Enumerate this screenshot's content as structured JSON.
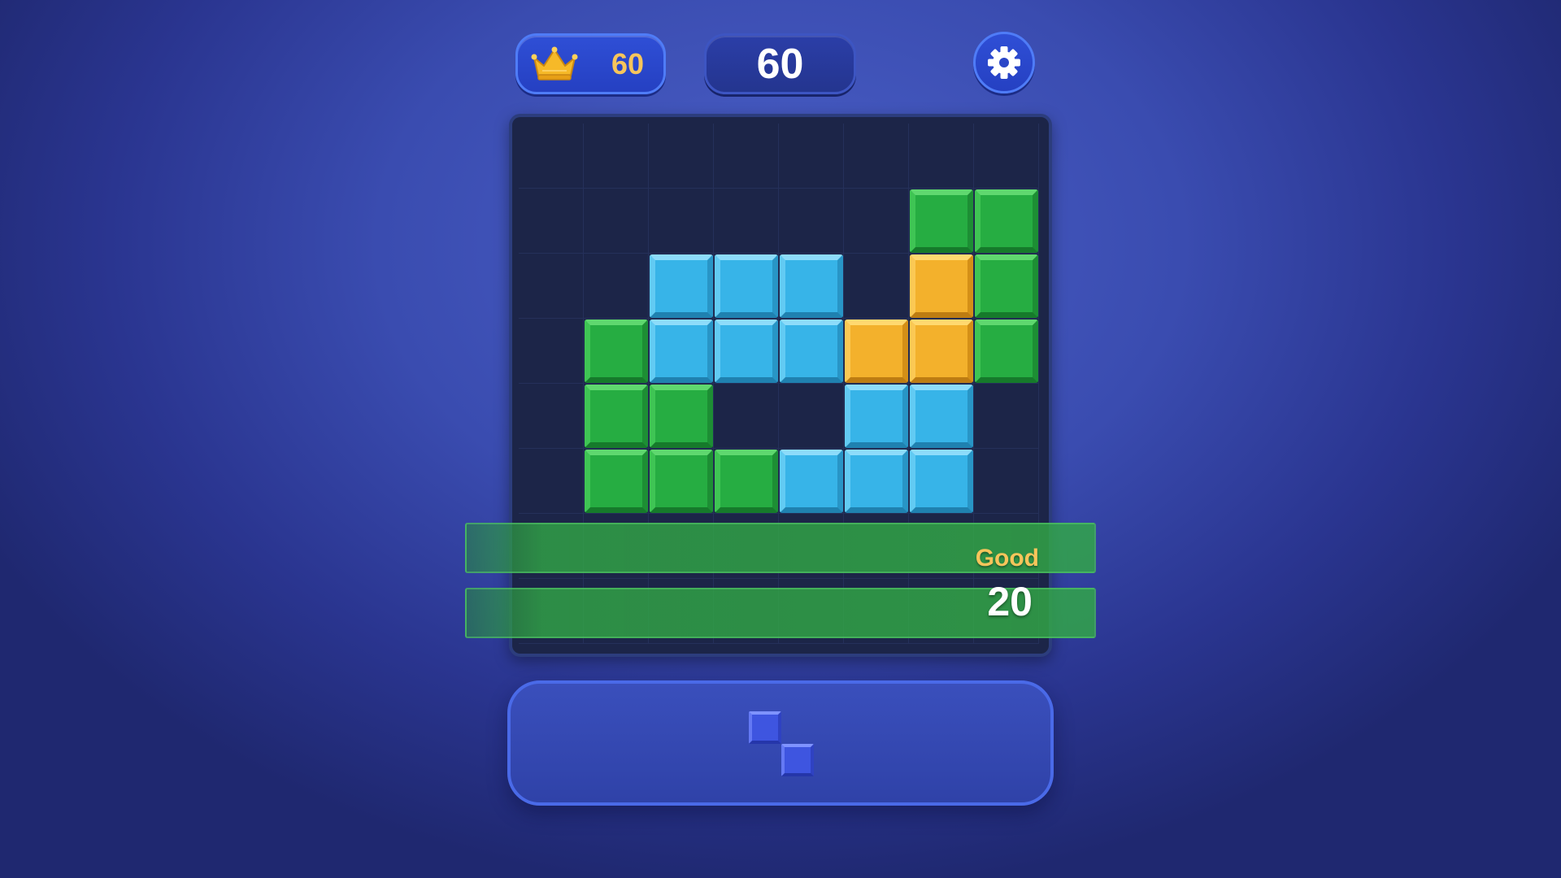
{
  "hud": {
    "best_score": "60",
    "best_icon": "crown-icon",
    "current_score": "60",
    "settings_icon": "gear-icon"
  },
  "board": {
    "rows": 8,
    "cols": 8,
    "blocks": [
      {
        "row": 1,
        "col": 6,
        "color": "green"
      },
      {
        "row": 1,
        "col": 7,
        "color": "green"
      },
      {
        "row": 2,
        "col": 2,
        "color": "blue"
      },
      {
        "row": 2,
        "col": 3,
        "color": "blue"
      },
      {
        "row": 2,
        "col": 4,
        "color": "blue"
      },
      {
        "row": 2,
        "col": 6,
        "color": "orange"
      },
      {
        "row": 2,
        "col": 7,
        "color": "green"
      },
      {
        "row": 3,
        "col": 1,
        "color": "green"
      },
      {
        "row": 3,
        "col": 2,
        "color": "blue"
      },
      {
        "row": 3,
        "col": 3,
        "color": "blue"
      },
      {
        "row": 3,
        "col": 4,
        "color": "blue"
      },
      {
        "row": 3,
        "col": 5,
        "color": "orange"
      },
      {
        "row": 3,
        "col": 6,
        "color": "orange"
      },
      {
        "row": 3,
        "col": 7,
        "color": "green"
      },
      {
        "row": 4,
        "col": 1,
        "color": "green"
      },
      {
        "row": 4,
        "col": 2,
        "color": "green"
      },
      {
        "row": 4,
        "col": 5,
        "color": "blue"
      },
      {
        "row": 4,
        "col": 6,
        "color": "blue"
      },
      {
        "row": 5,
        "col": 1,
        "color": "green"
      },
      {
        "row": 5,
        "col": 2,
        "color": "green"
      },
      {
        "row": 5,
        "col": 3,
        "color": "green"
      },
      {
        "row": 5,
        "col": 4,
        "color": "blue"
      },
      {
        "row": 5,
        "col": 5,
        "color": "blue"
      },
      {
        "row": 5,
        "col": 6,
        "color": "blue"
      }
    ],
    "cleared_rows": [
      6,
      7
    ],
    "colors": {
      "green": "#26ad42",
      "blue": "#37b4e8",
      "orange": "#f3b12c"
    }
  },
  "combo": {
    "label": "Good",
    "points": "20"
  },
  "tray": {
    "piece_color": "#3e55e0",
    "piece_cells": [
      {
        "row": 0,
        "col": 0
      },
      {
        "row": 1,
        "col": 1
      }
    ]
  }
}
